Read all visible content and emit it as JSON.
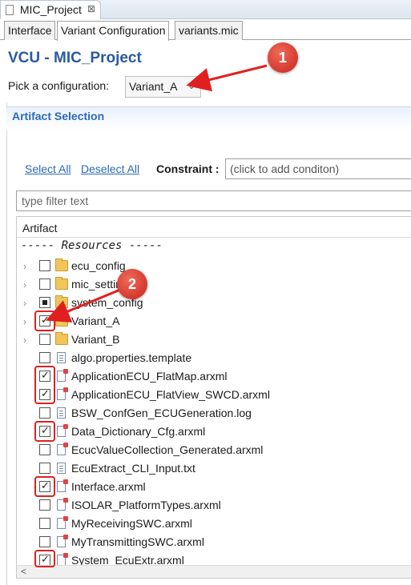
{
  "editor_tab": {
    "title": "MIC_Project",
    "close": "⊠"
  },
  "page_tabs": [
    "Interface",
    "Variant Configuration",
    "variants.mic"
  ],
  "header": {
    "title": "VCU - MIC_Project",
    "pick_label": "Pick a configuration:",
    "config_value": "Variant_A"
  },
  "section": {
    "title": "Artifact Selection",
    "select_all": "Select All",
    "deselect_all": "Deselect All",
    "constraint_label": "Constraint :",
    "constraint_placeholder": "(click to add conditon)",
    "filter_placeholder": "type filter text"
  },
  "tree": {
    "column_header": "Artifact",
    "resources_header": "----- Resources -----",
    "rows": [
      {
        "label": "ecu_config",
        "type": "folder",
        "expandable": true,
        "state": "unchecked"
      },
      {
        "label": "mic_settings",
        "type": "folder",
        "expandable": true,
        "state": "unchecked"
      },
      {
        "label": "system_config",
        "type": "folder",
        "expandable": true,
        "state": "partial"
      },
      {
        "label": "Variant_A",
        "type": "folder",
        "expandable": true,
        "state": "checked"
      },
      {
        "label": "Variant_B",
        "type": "folder",
        "expandable": true,
        "state": "unchecked"
      },
      {
        "label": "algo.properties.template",
        "type": "doc",
        "expandable": false,
        "state": "unchecked"
      },
      {
        "label": "ApplicationECU_FlatMap.arxml",
        "type": "arxml",
        "expandable": false,
        "state": "checked"
      },
      {
        "label": "ApplicationECU_FlatView_SWCD.arxml",
        "type": "arxml",
        "expandable": false,
        "state": "checked"
      },
      {
        "label": "BSW_ConfGen_ECUGeneration.log",
        "type": "doc",
        "expandable": false,
        "state": "unchecked"
      },
      {
        "label": "Data_Dictionary_Cfg.arxml",
        "type": "arxml",
        "expandable": false,
        "state": "checked"
      },
      {
        "label": "EcucValueCollection_Generated.arxml",
        "type": "arxml",
        "expandable": false,
        "state": "unchecked"
      },
      {
        "label": "EcuExtract_CLI_Input.txt",
        "type": "doc",
        "expandable": false,
        "state": "unchecked"
      },
      {
        "label": "Interface.arxml",
        "type": "arxml",
        "expandable": false,
        "state": "checked"
      },
      {
        "label": "ISOLAR_PlatformTypes.arxml",
        "type": "arxml",
        "expandable": false,
        "state": "unchecked"
      },
      {
        "label": "MyReceivingSWC.arxml",
        "type": "arxml",
        "expandable": false,
        "state": "unchecked"
      },
      {
        "label": "MyTransmittingSWC.arxml",
        "type": "arxml",
        "expandable": false,
        "state": "unchecked"
      },
      {
        "label": "System_EcuExtr.arxml",
        "type": "arxml",
        "expandable": false,
        "state": "checked"
      }
    ]
  },
  "callouts": [
    "1",
    "2"
  ],
  "colors": {
    "title": "#2a5aa0",
    "link": "#2a6ab8",
    "callout": "#d32f2f"
  }
}
